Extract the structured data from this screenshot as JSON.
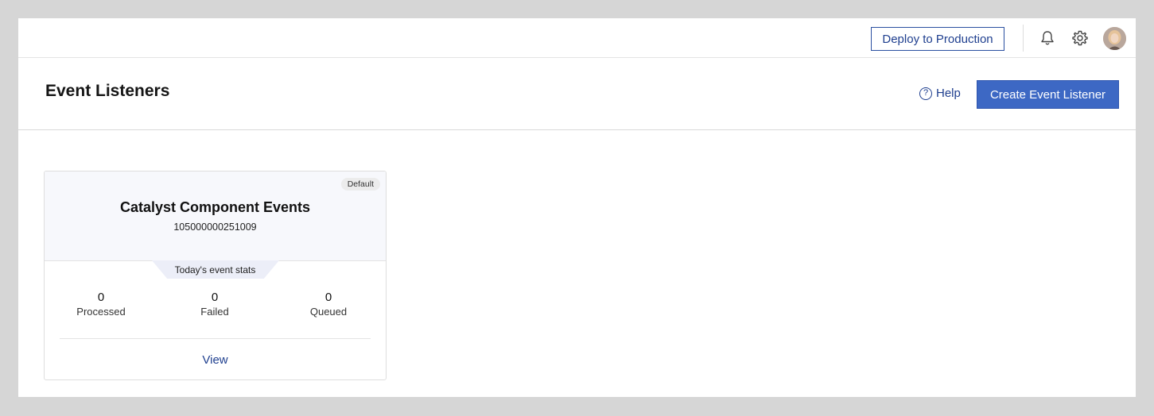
{
  "topbar": {
    "deploy_label": "Deploy to Production",
    "icons": [
      "bell-icon",
      "gear-icon"
    ],
    "avatar": "user-avatar"
  },
  "header": {
    "title": "Event Listeners",
    "help_label": "Help",
    "create_label": "Create Event Listener"
  },
  "card": {
    "badge": "Default",
    "title": "Catalyst Component Events",
    "id": "105000000251009",
    "stats_label": "Today's event stats",
    "stats": [
      {
        "value": "0",
        "label": "Processed"
      },
      {
        "value": "0",
        "label": "Failed"
      },
      {
        "value": "0",
        "label": "Queued"
      }
    ],
    "view_label": "View"
  },
  "colors": {
    "accent": "#3d68c4",
    "link": "#1f3f8f",
    "card_header_bg": "#f7f8fc"
  }
}
